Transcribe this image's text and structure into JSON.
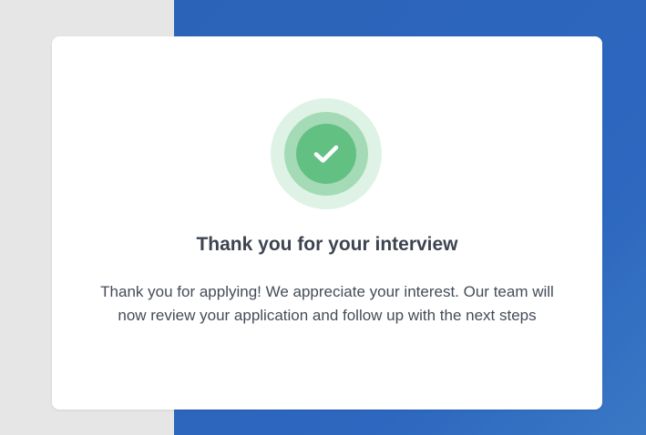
{
  "colors": {
    "page_background": "#e6e6e6",
    "blue_panel": "#2d67bf",
    "card_background": "#ffffff",
    "success_outer": "#dff2e6",
    "success_mid": "#a4dbb6",
    "success_inner": "#63c083",
    "title_text": "#3d4450",
    "body_text": "#454c58"
  },
  "icon": {
    "name": "checkmark-icon"
  },
  "card": {
    "title": "Thank you for your interview",
    "message": "Thank you for applying! We appreciate your interest. Our team will now review your application and follow up with the next steps"
  }
}
